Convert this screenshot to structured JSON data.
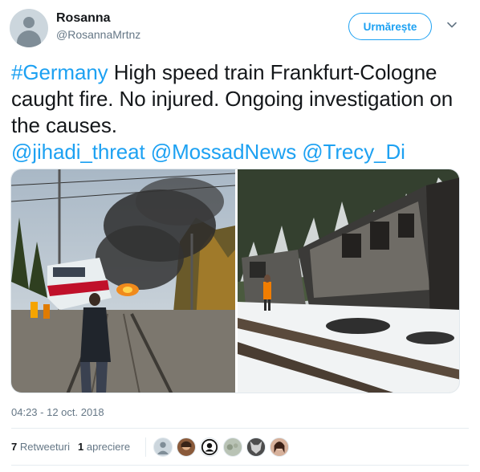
{
  "user": {
    "name": "Rosanna",
    "handle": "@RosannaMrtnz"
  },
  "follow_button": {
    "label": "Urmărește"
  },
  "tweet": {
    "hashtag": "#Germany",
    "body": " High speed train Frankfurt-Cologne caught fire. No injured. Ongoing investigation on the causes.",
    "mentions": [
      "@jihadi_threat",
      "@MossadNews",
      "@Trecy_Di"
    ]
  },
  "timestamp": "04:23 - 12 oct. 2018",
  "stats": {
    "retweets_count": "7",
    "retweets_label": "Retweeturi",
    "likes_count": "1",
    "likes_label": "apreciere"
  },
  "colors": {
    "link": "#1da1f2",
    "text": "#14171a",
    "secondary": "#657786"
  },
  "icons": {
    "caret": "chevron-down-icon"
  }
}
